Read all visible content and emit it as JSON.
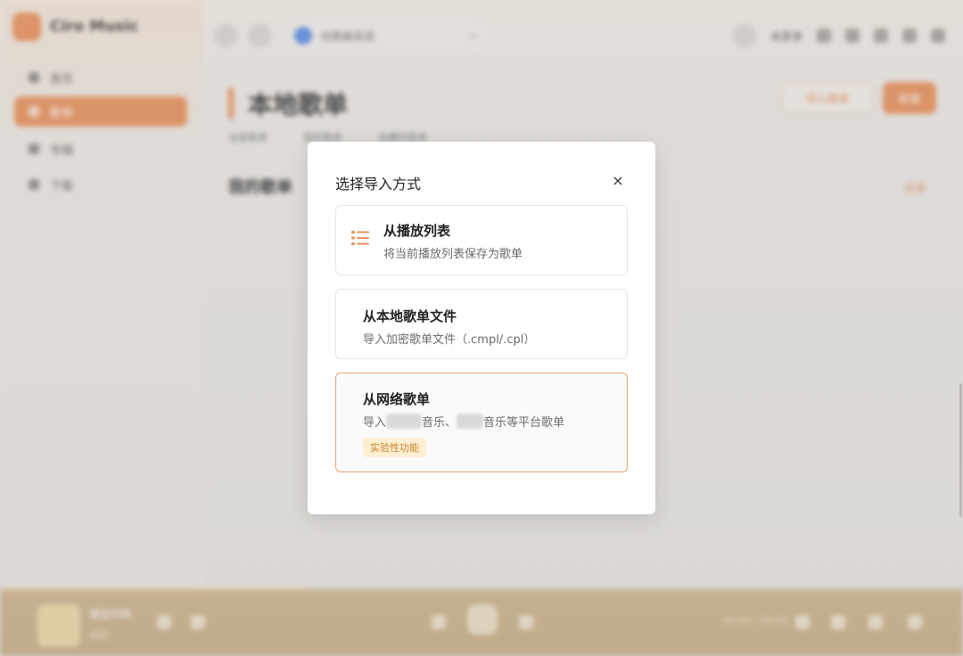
{
  "app": {
    "name": "Ciro Music"
  },
  "sidebar": {
    "items": [
      {
        "label": "首页",
        "active": false
      },
      {
        "label": "歌单",
        "active": true
      },
      {
        "label": "专辑",
        "active": false
      },
      {
        "label": "下载",
        "active": false
      }
    ]
  },
  "topbar": {
    "search_text": "向歌曲发送",
    "user_label": "未登录"
  },
  "page": {
    "title": "本地歌单",
    "import_button": "导入歌单",
    "new_button": "新建",
    "subtabs": [
      "全部歌单",
      "我的歌单",
      "收藏的歌单"
    ],
    "section_title": "我的歌单",
    "section_link": "全部"
  },
  "player": {
    "track_title": "播放列表",
    "track_artist": "未知",
    "time": "00:00 / 00:00",
    "progress": 0.32
  },
  "modal": {
    "title": "选择导入方式",
    "close_icon": "×",
    "options": [
      {
        "title": "从播放列表",
        "desc": "将当前播放列表保存为歌单",
        "icon": "list-icon"
      },
      {
        "title": "从本地歌单文件",
        "desc": "导入加密歌单文件（.cmpl/.cpl）"
      },
      {
        "title": "从网络歌单",
        "desc_prefix": "导入",
        "desc_mid": "音乐、",
        "desc_suffix": "音乐等平台歌单",
        "tag": "实验性功能"
      }
    ]
  },
  "colors": {
    "accent": "#e9915b",
    "selected_border": "#e9a57a",
    "tag_bg": "#fdefd2",
    "tag_text": "#c5832a"
  }
}
